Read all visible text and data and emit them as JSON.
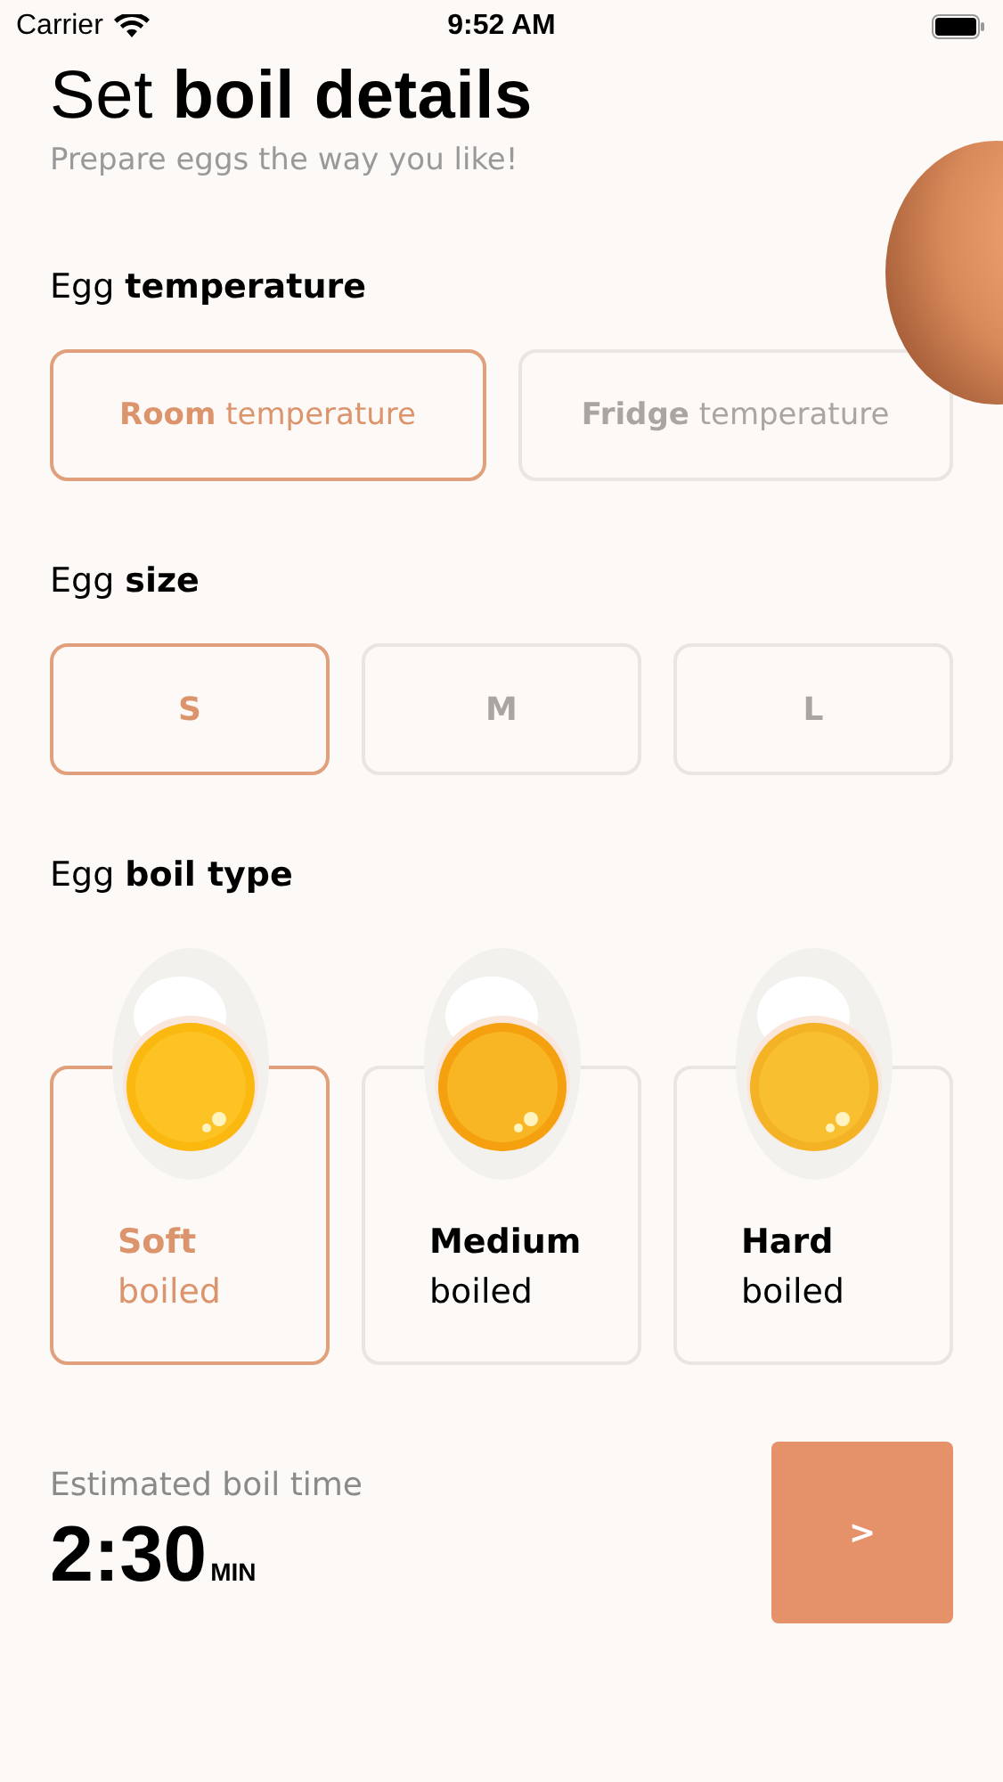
{
  "status_bar": {
    "carrier": "Carrier",
    "time": "9:52 AM"
  },
  "header": {
    "title": "Set **boil details**",
    "subtitle": "Prepare eggs the way you like!"
  },
  "temperature": {
    "heading": "Egg **temperature**",
    "options": [
      {
        "label": "**Room** temperature",
        "selected": true
      },
      {
        "label": "**Fridge** temperature",
        "selected": false
      }
    ]
  },
  "size": {
    "heading": "Egg **size**",
    "options": [
      {
        "label": "S",
        "selected": true
      },
      {
        "label": "M",
        "selected": false
      },
      {
        "label": "L",
        "selected": false
      }
    ]
  },
  "boil_type": {
    "heading": "Egg **boil type**",
    "options": [
      {
        "title": "Soft",
        "subtitle": "boiled",
        "selected": true,
        "color": "#fbb80f"
      },
      {
        "title": "Medium",
        "subtitle": "boiled",
        "selected": false,
        "color": "#f5a00e"
      },
      {
        "title": "Hard",
        "subtitle": "boiled",
        "selected": false,
        "color": "#f3b324"
      }
    ]
  },
  "estimate": {
    "label": "Estimated boil time",
    "value": "2:30",
    "unit": "MIN"
  },
  "next_button": {
    "label": ">"
  }
}
